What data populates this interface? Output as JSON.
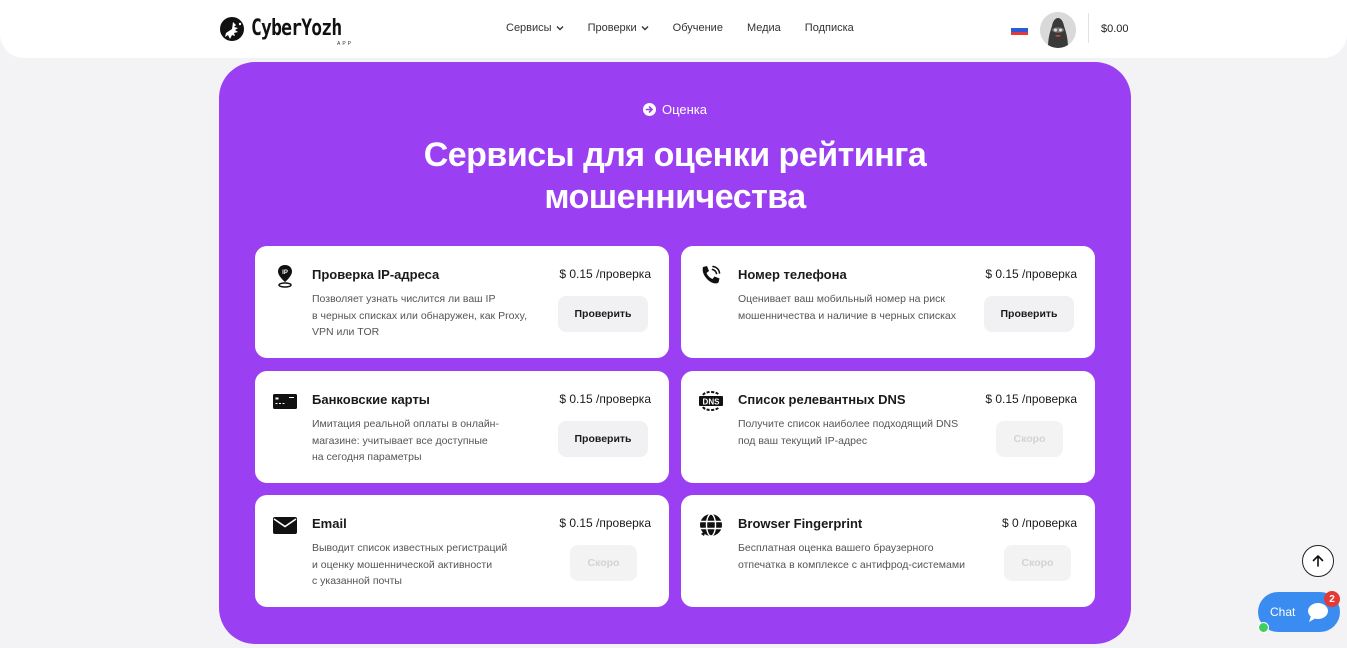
{
  "header": {
    "logo_text": "CyberYozh",
    "logo_sub": "APP",
    "nav": [
      {
        "label": "Сервисы",
        "has_dropdown": true
      },
      {
        "label": "Проверки",
        "has_dropdown": true
      },
      {
        "label": "Обучение",
        "has_dropdown": false
      },
      {
        "label": "Медиа",
        "has_dropdown": false
      },
      {
        "label": "Подписка",
        "has_dropdown": false
      }
    ],
    "language_flag": "ru-flag",
    "balance": "$0.00"
  },
  "hero": {
    "eyebrow": "Оценка",
    "title_line1": "Сервисы для оценки рейтинга",
    "title_line2": "мошенничества",
    "background_color": "#9b3ff2"
  },
  "cards": [
    {
      "icon": "ip-location-icon",
      "title": "Проверка IP-адреса",
      "price": "$ 0.15 /проверка",
      "desc": [
        "Позволяет узнать числится ли ваш IP",
        "в черных списках или обнаружен, как Proxy,",
        "VPN или TOR"
      ],
      "button": "Проверить",
      "button_enabled": true
    },
    {
      "icon": "phone-icon",
      "title": "Номер телефона",
      "price": "$ 0.15 /проверка",
      "desc": [
        "Оценивает ваш мобильный номер на риск",
        "мошенничества и наличие в черных списках"
      ],
      "button": "Проверить",
      "button_enabled": true
    },
    {
      "icon": "credit-card-icon",
      "title": "Банковские карты",
      "price": "$ 0.15 /проверка",
      "desc": [
        "Имитация реальной оплаты в онлайн-",
        "магазине: учитывает все доступные",
        "на сегодня параметры"
      ],
      "button": "Проверить",
      "button_enabled": true
    },
    {
      "icon": "dns-icon",
      "title": "Список релевантных DNS",
      "price": "$ 0.15 /проверка",
      "desc": [
        "Получите список наиболее подходящий DNS",
        "под ваш текущий IP-адрес"
      ],
      "button": "Скоро",
      "button_enabled": false
    },
    {
      "icon": "email-icon",
      "title": "Email",
      "price": "$ 0.15 /проверка",
      "desc": [
        "Выводит список известных регистраций",
        "и оценку мошеннической активности",
        "с указанной почты"
      ],
      "button": "Скоро",
      "button_enabled": false
    },
    {
      "icon": "globe-fingerprint-icon",
      "title": "Browser Fingerprint",
      "price": "$ 0 /проверка",
      "desc": [
        "Бесплатная оценка вашего браузерного",
        "отпечатка в комплексе с антифрод-системами"
      ],
      "button": "Скоро",
      "button_enabled": false
    }
  ],
  "widgets": {
    "chat_label": "Chat",
    "chat_badge": "2",
    "chat_color": "#3b8cf0"
  }
}
